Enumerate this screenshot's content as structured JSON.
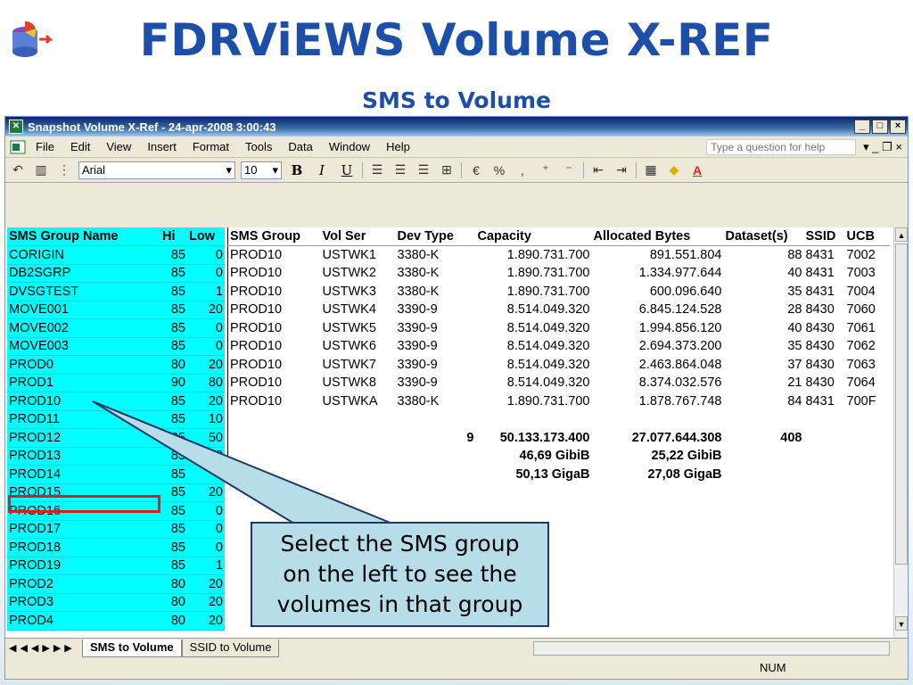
{
  "slide": {
    "title": "FDRViEWS Volume X-REF",
    "subtitle": "SMS to Volume"
  },
  "window": {
    "title": "Snapshot Volume X-Ref - 24-apr-2008 3:00:43",
    "buttons": [
      "_",
      "□",
      "×"
    ]
  },
  "menu": {
    "items": [
      "File",
      "Edit",
      "View",
      "Insert",
      "Format",
      "Tools",
      "Data",
      "Window",
      "Help"
    ],
    "help_placeholder": "Type a question for help",
    "doc_controls": "▾  _  ❐  ×"
  },
  "toolbar": {
    "font": "Arial",
    "size": "10",
    "bold": "B",
    "italic": "I",
    "underline": "U",
    "percent": "%",
    "comma": ","
  },
  "left_table": {
    "headers": [
      "SMS Group Name",
      "Hi",
      "Low"
    ],
    "rows": [
      [
        "CORIGIN",
        "85",
        "0"
      ],
      [
        "DB2SGRP",
        "85",
        "0"
      ],
      [
        "DVSGTEST",
        "85",
        "1"
      ],
      [
        "MOVE001",
        "85",
        "20"
      ],
      [
        "MOVE002",
        "85",
        "0"
      ],
      [
        "MOVE003",
        "85",
        "0"
      ],
      [
        "PROD0",
        "80",
        "20"
      ],
      [
        "PROD1",
        "90",
        "80"
      ],
      [
        "PROD10",
        "85",
        "20"
      ],
      [
        "PROD11",
        "85",
        "10"
      ],
      [
        "PROD12",
        "85",
        "50"
      ],
      [
        "PROD13",
        "85",
        "0"
      ],
      [
        "PROD14",
        "85",
        "0"
      ],
      [
        "PROD15",
        "85",
        "20"
      ],
      [
        "PROD16",
        "85",
        "0"
      ],
      [
        "PROD17",
        "85",
        "0"
      ],
      [
        "PROD18",
        "85",
        "0"
      ],
      [
        "PROD19",
        "85",
        "1"
      ],
      [
        "PROD2",
        "80",
        "20"
      ],
      [
        "PROD3",
        "80",
        "20"
      ],
      [
        "PROD4",
        "80",
        "20"
      ]
    ]
  },
  "right_table": {
    "headers": [
      "SMS Group",
      "Vol Ser",
      "Dev Type",
      "Capacity",
      "Allocated Bytes",
      "Dataset(s)",
      "SSID",
      "UCB"
    ],
    "rows": [
      [
        "PROD10",
        "USTWK1",
        "3380-K",
        "1.890.731.700",
        "891.551.804",
        "88",
        "8431",
        "7002"
      ],
      [
        "PROD10",
        "USTWK2",
        "3380-K",
        "1.890.731.700",
        "1.334.977.644",
        "40",
        "8431",
        "7003"
      ],
      [
        "PROD10",
        "USTWK3",
        "3380-K",
        "1.890.731.700",
        "600.096.640",
        "35",
        "8431",
        "7004"
      ],
      [
        "PROD10",
        "USTWK4",
        "3390-9",
        "8.514.049.320",
        "6.845.124.528",
        "28",
        "8430",
        "7060"
      ],
      [
        "PROD10",
        "USTWK5",
        "3390-9",
        "8.514.049.320",
        "1.994.856.120",
        "40",
        "8430",
        "7061"
      ],
      [
        "PROD10",
        "USTWK6",
        "3390-9",
        "8.514.049.320",
        "2.694.373.200",
        "35",
        "8430",
        "7062"
      ],
      [
        "PROD10",
        "USTWK7",
        "3390-9",
        "8.514.049.320",
        "2.463.864.048",
        "37",
        "8430",
        "7063"
      ],
      [
        "PROD10",
        "USTWK8",
        "3390-9",
        "8.514.049.320",
        "8.374.032.576",
        "21",
        "8430",
        "7064"
      ],
      [
        "PROD10",
        "USTWKA",
        "3380-K",
        "1.890.731.700",
        "1.878.767.748",
        "84",
        "8431",
        "700F"
      ]
    ],
    "totals": {
      "count": "9",
      "capacity": "50.133.173.400",
      "allocated": "27.077.644.308",
      "datasets": "408",
      "capacity_gibib": "46,69 GibiB",
      "allocated_gibib": "25,22 GibiB",
      "capacity_gigab": "50,13 GigaB",
      "allocated_gigab": "27,08 GigaB"
    }
  },
  "callout": {
    "line1": "Select the SMS group",
    "line2": "on the left to see the",
    "line3": "volumes in that group"
  },
  "tabs": [
    "SMS to Volume",
    "SSID to Volume"
  ],
  "status": {
    "num": "NUM"
  }
}
